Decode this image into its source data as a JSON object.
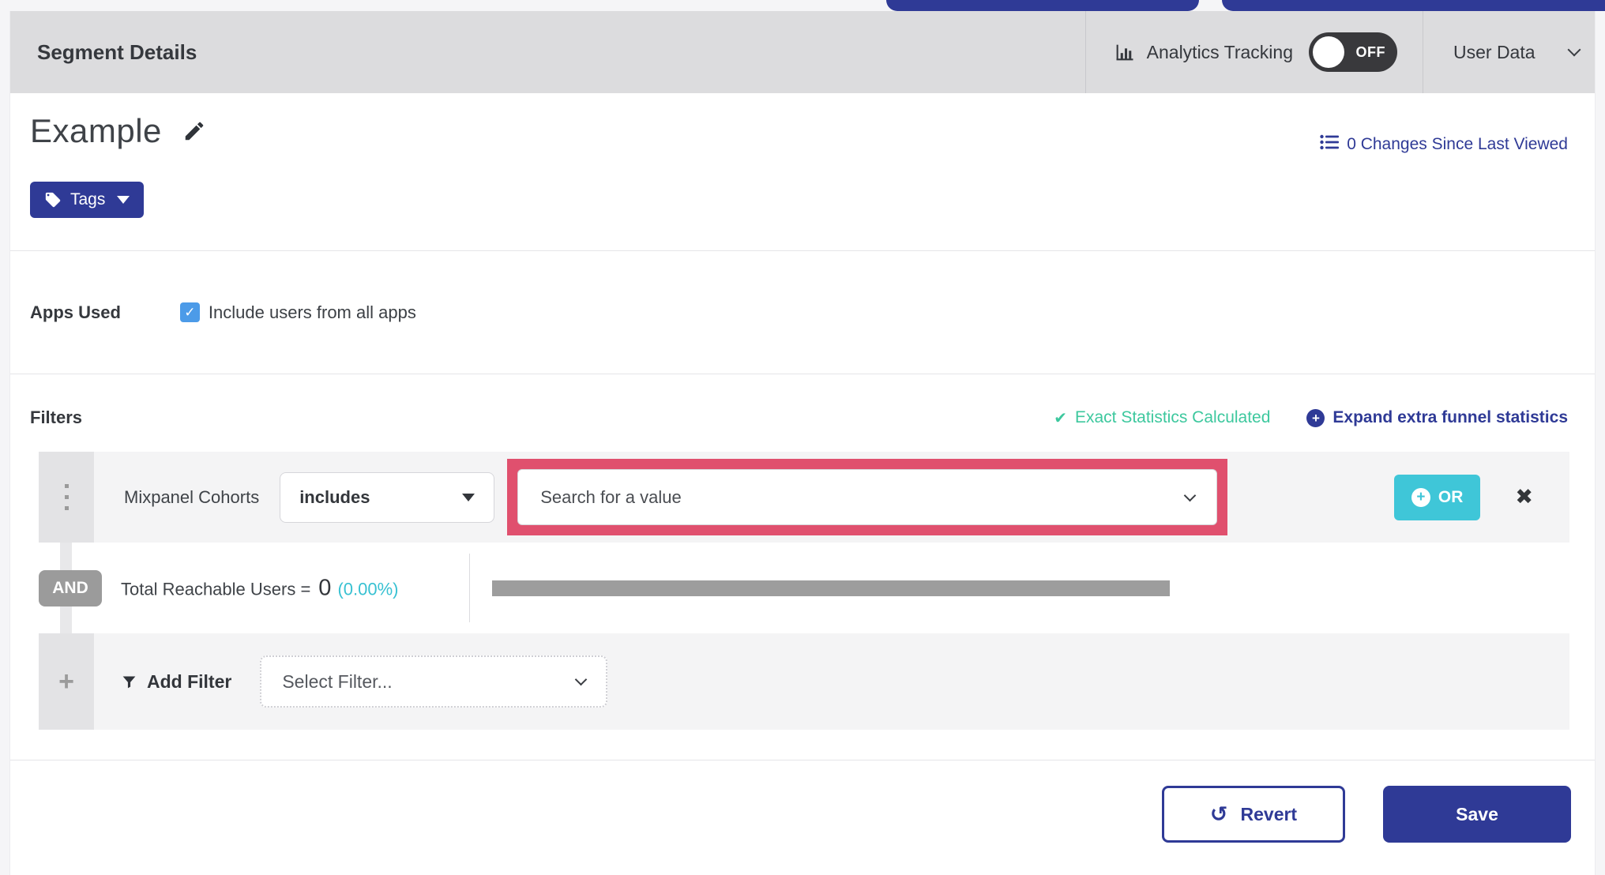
{
  "header": {
    "title": "Segment Details",
    "analytics_tracking_label": "Analytics Tracking",
    "toggle_state": "OFF",
    "user_data_label": "User Data"
  },
  "segment": {
    "name": "Example",
    "tags_label": "Tags",
    "changes_link": "0 Changes Since Last Viewed"
  },
  "apps_used": {
    "label": "Apps Used",
    "checkbox_label": "Include users from all apps",
    "checked": true,
    "check_glyph": "✓"
  },
  "filters": {
    "heading": "Filters",
    "exact_statistics_label": "Exact Statistics Calculated",
    "exact_check_glyph": "✔",
    "expand_statistics_label": "Expand extra funnel statistics",
    "plus_glyph": "+",
    "row": {
      "name": "Mixpanel Cohorts",
      "operator": "includes",
      "value_placeholder": "Search for a value",
      "or_label": "OR",
      "close_glyph": "✖"
    },
    "and_label": "AND",
    "total_reachable_label": "Total Reachable Users =",
    "total_reachable_value": "0",
    "total_reachable_percent": "(0.00%)",
    "add_filter_label": "Add Filter",
    "select_filter_placeholder": "Select Filter..."
  },
  "footer": {
    "revert_label": "Revert",
    "revert_glyph": "↺",
    "save_label": "Save"
  },
  "colors": {
    "indigo_accent": "#2f3a96",
    "teal_or_button": "#3fc6d8",
    "success_green": "#3dc89e",
    "percent_cyan": "#38c1d2",
    "highlight_pink": "#e0506e",
    "checkbox_blue": "#4c9be8",
    "header_bg": "#dcdcde",
    "and_badge_gray": "#9b9b9b",
    "reach_bar_gray": "#9d9d9d"
  }
}
